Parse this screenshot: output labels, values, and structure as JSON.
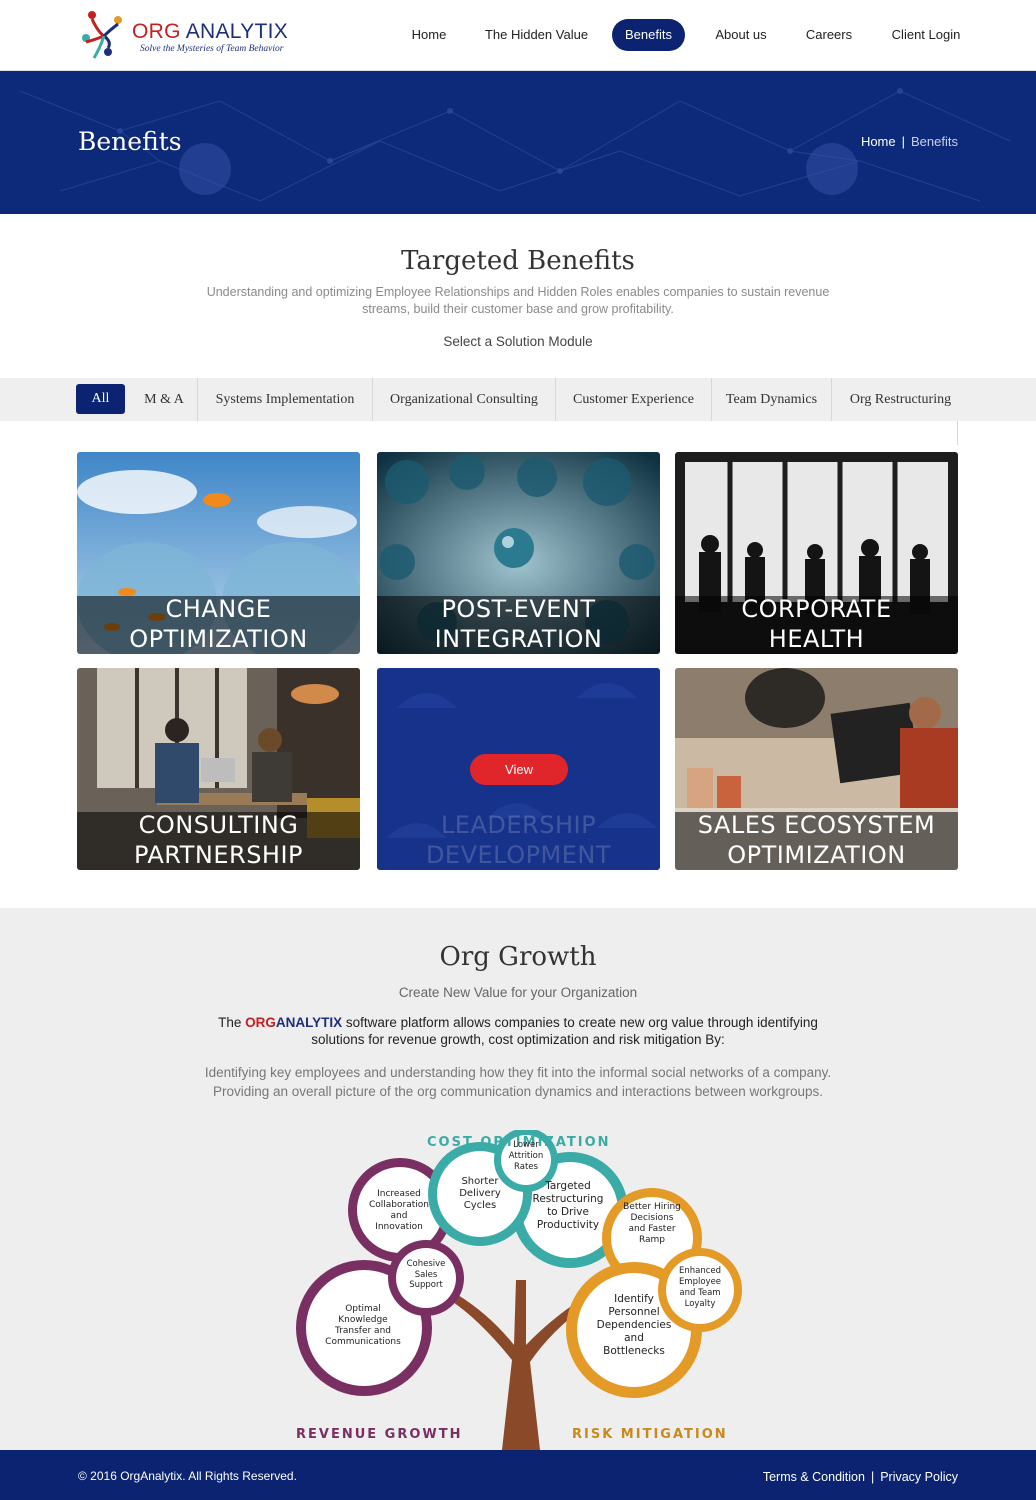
{
  "header": {
    "logo": {
      "brand_a": "ORG",
      "brand_b": " ANALYTIX",
      "tagline": "Solve the Mysteries of Team Behavior"
    },
    "nav": [
      "Home",
      "The Hidden Value",
      "Benefits",
      "About us",
      "Careers",
      "Client Login"
    ],
    "active_nav": "Benefits"
  },
  "banner": {
    "title": "Benefits",
    "breadcrumb_home": "Home",
    "breadcrumb_sep": "|",
    "breadcrumb_current": "Benefits"
  },
  "targeted": {
    "title": "Targeted Benefits",
    "text": "Understanding and optimizing Employee Relationships and Hidden Roles enables companies to sustain revenue streams, build their customer base and grow profitability.",
    "subtitle": "Select a Solution Module"
  },
  "filters": [
    "All",
    "M & A",
    "Systems Implementation",
    "Organizational Consulting",
    "Customer Experience",
    "Team Dynamics",
    "Org Restructuring"
  ],
  "cards": [
    {
      "label": "CHANGE\nOPTIMIZATION"
    },
    {
      "label": "POST-EVENT\nINTEGRATION"
    },
    {
      "label": "CORPORATE\nHEALTH"
    },
    {
      "label": "CONSULTING\nPARTNERSHIP"
    },
    {
      "label": "LEADERSHIP\nDEVELOPMENT",
      "button": "View"
    },
    {
      "label": "SALES ECOSYSTEM\nOPTIMIZATION"
    }
  ],
  "growth": {
    "title": "Org Growth",
    "subtitle": "Create New Value for your Organization",
    "para1_pre": "The ",
    "para1_org": "ORG",
    "para1_analytix": "ANALYTIX",
    "para1_post": " software platform allows companies to create new org value through identifying solutions for revenue growth, cost optimization and risk mitigation By:",
    "para2_line1": "Identifying key employees and understanding how they fit into the informal social networks of a company.",
    "para2_line2": "Providing an overall picture of the org communication dynamics and interactions between workgroups.",
    "diagram": {
      "cost_label": "COST OPTIMIZATION",
      "revenue_label": "REVENUE GROWTH",
      "risk_label": "RISK MITIGATION",
      "bubbles": {
        "lower_attrition": "Lower\nAttrition\nRates",
        "shorter_delivery": "Shorter\nDelivery\nCycles",
        "targeted_restructuring": "Targeted\nRestructuring\nto Drive\nProductivity",
        "increased_collab": "Increased\nCollaboration\nand\nInnovation",
        "cohesive_sales": "Cohesive\nSales\nSupport",
        "optimal_knowledge": "Optimal\nKnowledge\nTransfer and\nCommunications",
        "better_hiring": "Better Hiring\nDecisions\nand Faster\nRamp",
        "enhanced_employee": "Enhanced\nEmployee\nand Team\nLoyalty",
        "identify_personnel": "Identify\nPersonnel\nDependencies\nand\nBottlenecks"
      },
      "colors": {
        "teal": "#3aaba6",
        "purple": "#7a2f63",
        "orange": "#e39a26",
        "trunk": "#8a4a2a"
      }
    }
  },
  "footer": {
    "copyright": "© 2016 OrgAnalytix. All Rights Reserved.",
    "terms": "Terms & Condition",
    "sep": "|",
    "privacy": "Privacy Policy"
  }
}
